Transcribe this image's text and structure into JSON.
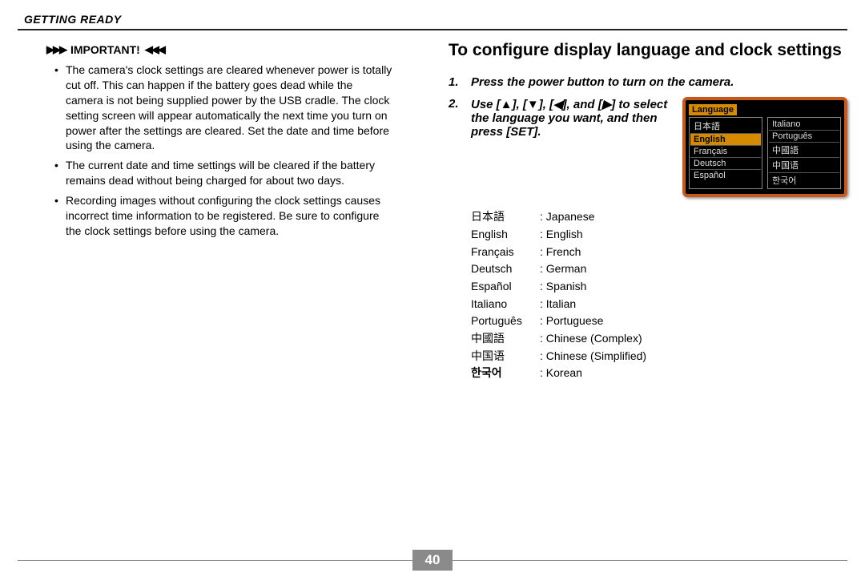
{
  "section_header": "GETTING READY",
  "left": {
    "important_label": "IMPORTANT!",
    "bullets": [
      "The camera's clock settings are cleared whenever power is totally cut off. This can happen if the battery goes dead while the camera is not being supplied power by the USB cradle. The clock setting screen will appear automatically the next time you turn on power after the settings are cleared. Set the date and time before using the camera.",
      "The current date and time settings will be cleared if the battery remains dead without being charged for about two days.",
      "Recording images without configuring the clock settings causes incorrect time information to be registered. Be sure to configure the clock settings before using the camera."
    ]
  },
  "right": {
    "title": "To configure display language and clock settings",
    "step1": "Press the power button to turn on the camera.",
    "step2": "Use [▲], [▼], [◀], and [▶] to select the language you want, and then press [SET].",
    "screen": {
      "title": "Language",
      "left_col": [
        "日本語",
        "English",
        "Français",
        "Deutsch",
        "Español"
      ],
      "right_col": [
        "Italiano",
        "Português",
        "中國語",
        "中国语",
        "한국어"
      ],
      "selected": "English"
    },
    "langs": [
      {
        "n": "日本語",
        "d": "Japanese"
      },
      {
        "n": "English",
        "d": "English"
      },
      {
        "n": "Français",
        "d": "French"
      },
      {
        "n": "Deutsch",
        "d": "German"
      },
      {
        "n": "Español",
        "d": "Spanish"
      },
      {
        "n": "Italiano",
        "d": "Italian"
      },
      {
        "n": "Português",
        "d": "Portuguese"
      },
      {
        "n": "中國語",
        "d": "Chinese (Complex)"
      },
      {
        "n": "中国语",
        "d": "Chinese (Simplified)"
      },
      {
        "n": "한국어",
        "d": "Korean",
        "bold": true
      }
    ]
  },
  "page_number": "40"
}
